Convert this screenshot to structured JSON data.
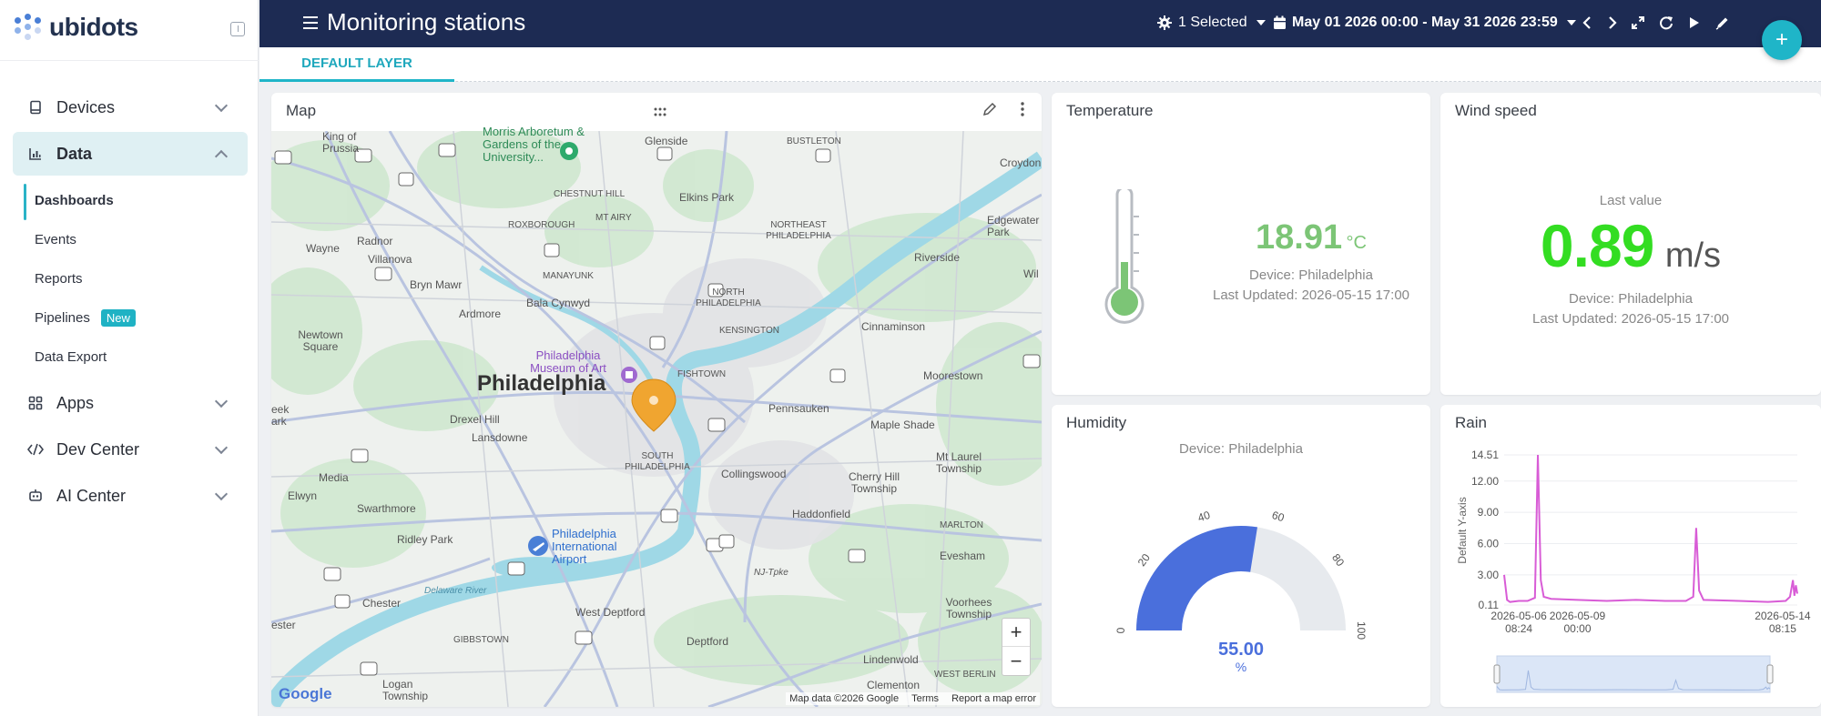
{
  "sidebar": {
    "logo_text": "ubidots",
    "items": [
      {
        "label": "Devices",
        "icon": "device-icon"
      },
      {
        "label": "Data",
        "icon": "chart-icon"
      },
      {
        "label": "Apps",
        "icon": "apps-icon"
      },
      {
        "label": "Dev Center",
        "icon": "code-icon"
      },
      {
        "label": "AI Center",
        "icon": "robot-icon"
      }
    ],
    "data_subitems": [
      {
        "label": "Dashboards"
      },
      {
        "label": "Events"
      },
      {
        "label": "Reports"
      },
      {
        "label": "Pipelines",
        "badge": "New"
      },
      {
        "label": "Data Export"
      }
    ]
  },
  "header": {
    "title": "Monitoring stations",
    "device_selector": "1 Selected",
    "date_range": "May 01 2026 00:00 - May 31 2026 23:59",
    "add_label": "+"
  },
  "tabs": [
    {
      "label": "DEFAULT LAYER"
    }
  ],
  "map_widget": {
    "title": "Map",
    "marker_label": "Philadelphia",
    "zoom_in": "+",
    "zoom_out": "−",
    "attribution": [
      "Map data ©2026 Google",
      "Terms",
      "Report a map error"
    ],
    "google": "Google",
    "places": [
      {
        "name": "King of Prussia"
      },
      {
        "name": "Morris Arboretum & Gardens of the University..."
      },
      {
        "name": "Glenside"
      },
      {
        "name": "BUSTLETON"
      },
      {
        "name": "Croydon"
      },
      {
        "name": "CHESTNUT HILL"
      },
      {
        "name": "Elkins Park"
      },
      {
        "name": "NORTHEAST PHILADELPHIA"
      },
      {
        "name": "MT AIRY"
      },
      {
        "name": "ROXBOROUGH"
      },
      {
        "name": "Wayne"
      },
      {
        "name": "Radnor"
      },
      {
        "name": "Villanova"
      },
      {
        "name": "Edgewater Park"
      },
      {
        "name": "Riverside"
      },
      {
        "name": "Wil"
      },
      {
        "name": "MANAYUNK"
      },
      {
        "name": "Bryn Mawr"
      },
      {
        "name": "Bala Cynwyd"
      },
      {
        "name": "NORTH PHILADELPHIA"
      },
      {
        "name": "Ardmore"
      },
      {
        "name": "KENSINGTON"
      },
      {
        "name": "Cinnaminson"
      },
      {
        "name": "Newtown Square"
      },
      {
        "name": "Philadelphia Museum of Art"
      },
      {
        "name": "FISHTOWN"
      },
      {
        "name": "Moorestown"
      },
      {
        "name": "Drexel Hill"
      },
      {
        "name": "Pennsauken"
      },
      {
        "name": "Maple Shade"
      },
      {
        "name": "eek ark"
      },
      {
        "name": "Lansdowne"
      },
      {
        "name": "SOUTH PHILADELPHIA"
      },
      {
        "name": "Collingswood"
      },
      {
        "name": "Mt Laurel Township"
      },
      {
        "name": "Media"
      },
      {
        "name": "Cherry Hill Township"
      },
      {
        "name": "Elwyn"
      },
      {
        "name": "Haddonfield"
      },
      {
        "name": "Swarthmore"
      },
      {
        "name": "MARLTON"
      },
      {
        "name": "Ridley Park"
      },
      {
        "name": "Philadelphia International Airport"
      },
      {
        "name": "Evesham"
      },
      {
        "name": "Delaware River"
      },
      {
        "name": "NJ-Tpke"
      },
      {
        "name": "Chester"
      },
      {
        "name": "West Deptford"
      },
      {
        "name": "Voorhees Township"
      },
      {
        "name": "ester"
      },
      {
        "name": "GIBBSTOWN"
      },
      {
        "name": "Deptford"
      },
      {
        "name": "Lindenwold"
      },
      {
        "name": "WEST BERLIN"
      },
      {
        "name": "Logan Township"
      },
      {
        "name": "Clementon"
      }
    ]
  },
  "temperature_widget": {
    "title": "Temperature",
    "value": "18.91",
    "unit": "°C",
    "device": "Device: Philadelphia",
    "updated": "Last Updated: 2026-05-15 17:00",
    "color": "#7cc576"
  },
  "wind_widget": {
    "title": "Wind speed",
    "caption": "Last value",
    "value": "0.89",
    "unit": "m/s",
    "device": "Device: Philadelphia",
    "updated": "Last Updated: 2026-05-15 17:00",
    "color": "#33dd22"
  },
  "humidity_widget": {
    "title": "Humidity",
    "device": "Device: Philadelphia",
    "value": "55.00",
    "unit": "%",
    "fraction": 0.55,
    "ticks": [
      "0",
      "20",
      "40",
      "60",
      "80",
      "100"
    ],
    "fill_color": "#4a6fdc",
    "track_color": "#e7eaee"
  },
  "rain_widget": {
    "title": "Rain",
    "chart_data": {
      "type": "line",
      "ylabel": "Default Y-axis",
      "yticks": [
        "14.51",
        "12.00",
        "9.00",
        "6.00",
        "3.00",
        "0.11"
      ],
      "ylim": [
        0.11,
        14.51
      ],
      "xticks": [
        {
          "line1": "2026-05-06",
          "line2": "08:24"
        },
        {
          "line1": "2026-05-09",
          "line2": "00:00"
        },
        {
          "line1": "2026-05-14",
          "line2": "08:15"
        }
      ],
      "series": [
        {
          "color": "#d85cd6",
          "points": [
            [
              0.0,
              3.0
            ],
            [
              0.01,
              0.6
            ],
            [
              0.02,
              0.4
            ],
            [
              0.05,
              0.5
            ],
            [
              0.08,
              0.5
            ],
            [
              0.105,
              0.8
            ],
            [
              0.115,
              14.51
            ],
            [
              0.125,
              2.5
            ],
            [
              0.135,
              0.9
            ],
            [
              0.16,
              0.7
            ],
            [
              0.25,
              0.6
            ],
            [
              0.35,
              0.5
            ],
            [
              0.45,
              0.6
            ],
            [
              0.55,
              0.5
            ],
            [
              0.62,
              0.5
            ],
            [
              0.645,
              0.9
            ],
            [
              0.655,
              7.5
            ],
            [
              0.665,
              1.5
            ],
            [
              0.68,
              0.6
            ],
            [
              0.8,
              0.5
            ],
            [
              0.9,
              0.4
            ],
            [
              0.96,
              0.5
            ],
            [
              0.975,
              0.9
            ],
            [
              0.985,
              2.5
            ],
            [
              0.99,
              1.0
            ],
            [
              0.995,
              2.0
            ],
            [
              1.0,
              1.2
            ]
          ]
        }
      ]
    }
  }
}
